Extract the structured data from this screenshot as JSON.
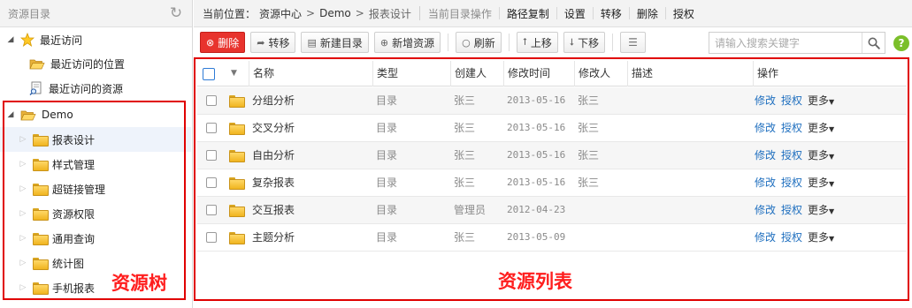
{
  "left": {
    "title": "资源目录",
    "recent": {
      "label": "最近访问",
      "children": [
        "最近访问的位置",
        "最近访问的资源"
      ]
    },
    "root": {
      "label": "Demo",
      "children": [
        "报表设计",
        "样式管理",
        "超链接管理",
        "资源权限",
        "通用查询",
        "统计图",
        "手机报表"
      ]
    },
    "annotation": "资源树"
  },
  "breadcrumb": {
    "prefix": "当前位置：",
    "items": [
      "资源中心",
      "Demo",
      "报表设计"
    ],
    "separator": ">"
  },
  "topActions": {
    "heading": "当前目录操作",
    "links": [
      "路径复制",
      "设置",
      "转移",
      "删除",
      "授权"
    ]
  },
  "toolbar": {
    "delete": "删除",
    "move": "转移",
    "newFolder": "新建目录",
    "newResource": "新增资源",
    "refresh": "刷新",
    "up": "上移",
    "down": "下移",
    "search_placeholder": "请输入搜索关键字"
  },
  "table": {
    "columns": [
      "名称",
      "类型",
      "创建人",
      "修改时间",
      "修改人",
      "描述",
      "操作"
    ],
    "rows": [
      {
        "name": "分组分析",
        "type": "目录",
        "creator": "张三",
        "modified": "2013-05-16",
        "modifier": "张三"
      },
      {
        "name": "交叉分析",
        "type": "目录",
        "creator": "张三",
        "modified": "2013-05-16",
        "modifier": "张三"
      },
      {
        "name": "自由分析",
        "type": "目录",
        "creator": "张三",
        "modified": "2013-05-16",
        "modifier": "张三"
      },
      {
        "name": "复杂报表",
        "type": "目录",
        "creator": "张三",
        "modified": "2013-05-16",
        "modifier": "张三"
      },
      {
        "name": "交互报表",
        "type": "目录",
        "creator": "管理员",
        "modified": "2012-04-23",
        "modifier": ""
      },
      {
        "name": "主题分析",
        "type": "目录",
        "creator": "张三",
        "modified": "2013-05-09",
        "modifier": ""
      }
    ],
    "actions": {
      "edit": "修改",
      "grant": "授权",
      "more": "更多"
    },
    "annotation": "资源列表"
  },
  "colors": {
    "accent": "#1f6fbf",
    "danger": "#e8332d",
    "annotation": "#ff1e1e",
    "help": "#7bbf2a"
  }
}
